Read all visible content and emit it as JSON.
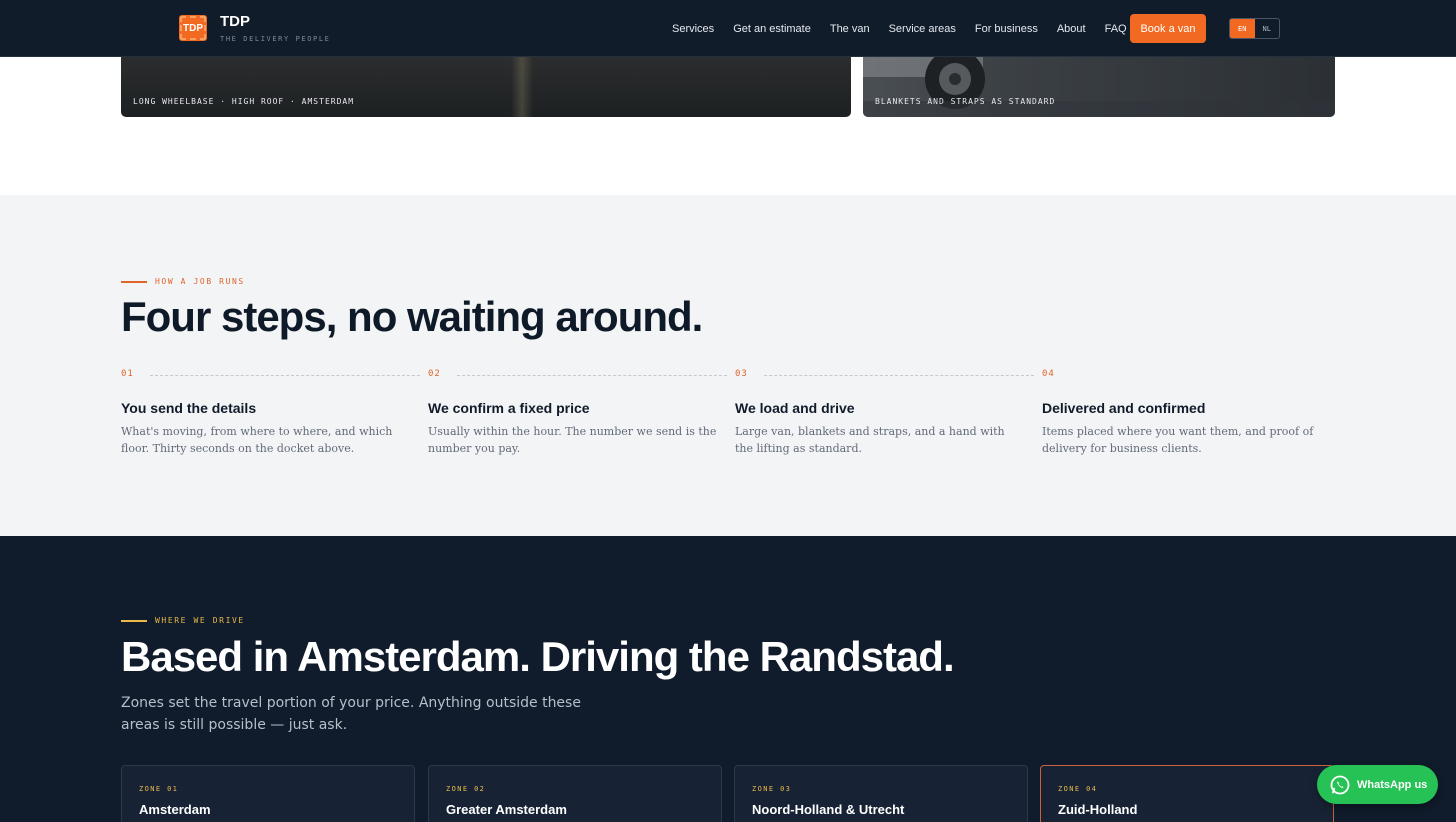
{
  "header": {
    "logo_badge": "TDP",
    "brand_name": "TDP",
    "brand_tagline": "THE DELIVERY PEOPLE",
    "nav": [
      "Services",
      "Get an estimate",
      "The van",
      "Service areas",
      "For business",
      "About",
      "FAQ"
    ],
    "cta": "Book a van",
    "languages": [
      "EN",
      "NL"
    ],
    "active_language": "EN"
  },
  "photos": [
    {
      "caption": "LONG WHEELBASE · HIGH ROOF · AMSTERDAM"
    },
    {
      "caption": "BLANKETS AND STRAPS AS STANDARD"
    }
  ],
  "steps_section": {
    "eyebrow": "HOW A JOB RUNS",
    "heading": "Four steps, no waiting around.",
    "steps": [
      {
        "num": "01",
        "title": "You send the details",
        "desc": "What's moving, from where to where, and which floor. Thirty seconds on the docket above."
      },
      {
        "num": "02",
        "title": "We confirm a fixed price",
        "desc": "Usually within the hour. The number we send is the number you pay."
      },
      {
        "num": "03",
        "title": "We load and drive",
        "desc": "Large van, blankets and straps, and a hand with the lifting as standard."
      },
      {
        "num": "04",
        "title": "Delivered and confirmed",
        "desc": "Items placed where you want them, and proof of delivery for business clients."
      }
    ]
  },
  "zones_section": {
    "eyebrow": "WHERE WE DRIVE",
    "heading": "Based in Amsterdam. Driving the Randstad.",
    "subtitle": "Zones set the travel portion of your price. Anything outside these areas is still possible — just ask.",
    "zones": [
      {
        "label": "ZONE 01",
        "name": "Amsterdam"
      },
      {
        "label": "ZONE 02",
        "name": "Greater Amsterdam"
      },
      {
        "label": "ZONE 03",
        "name": "Noord-Holland & Utrecht"
      },
      {
        "label": "ZONE 04",
        "name": "Zuid-Holland"
      }
    ]
  },
  "whatsapp": {
    "label": "WhatsApp us"
  },
  "colors": {
    "accent": "#f26a22",
    "navy": "#101b2b",
    "gold": "#e9b94a",
    "whatsapp": "#27c256"
  }
}
